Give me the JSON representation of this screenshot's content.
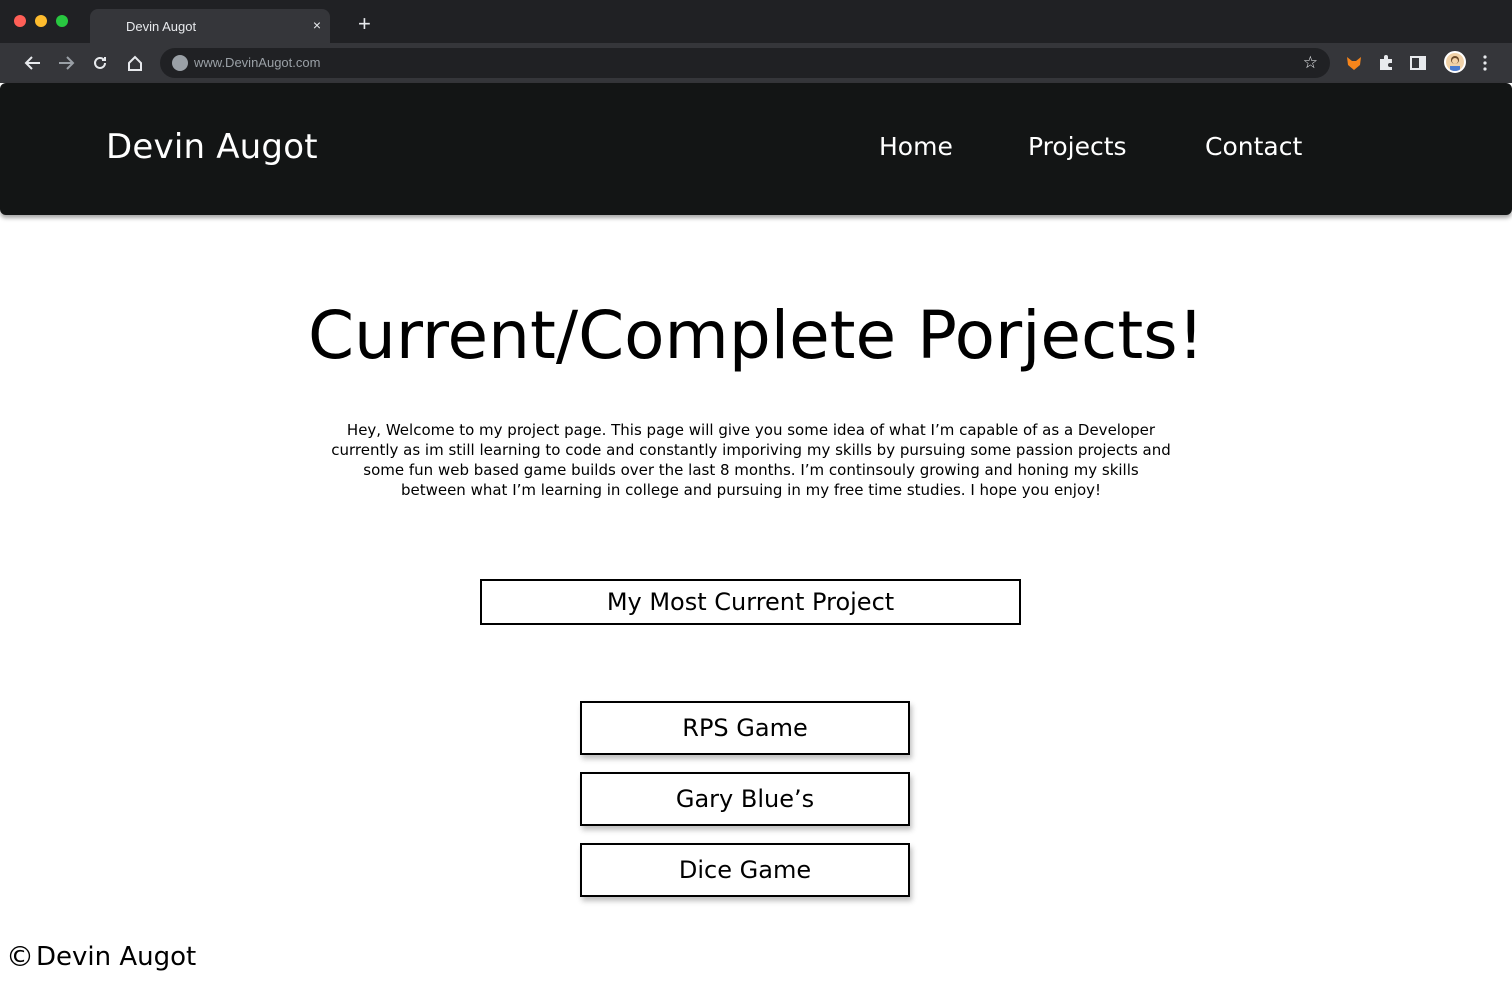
{
  "browser": {
    "tab_title": "Devin Augot",
    "tab_close": "×",
    "new_tab": "+",
    "url": "www.DevinAugot.com",
    "icons": [
      "back-icon",
      "forward-icon",
      "reload-icon",
      "home-icon",
      "star-icon",
      "fox-extension-icon",
      "puzzle-extension-icon",
      "side-panel-icon",
      "profile-avatar",
      "kebab-menu-icon"
    ]
  },
  "header": {
    "brand": "Devin Augot",
    "nav": [
      "Home",
      "Projects",
      "Contact"
    ]
  },
  "main": {
    "title": "Current/Complete Porjects!",
    "intro": "Hey, Welcome to my project page. This page will give you some idea of what I’m capable of as a Developer currently as im still learning to code and constantly imporiving my skills by pursuing some passion projects and some fun web based game builds over the last 8 months. I’m continsouly growing and honing my skills between what I’m learning in college and pursuing in my free time studies. I hope you enjoy!",
    "current_project_label": "My Most Current Project",
    "projects": [
      "RPS Game",
      "Gary Blue’s",
      "Dice Game"
    ]
  },
  "footer": {
    "copyright_symbol": "©",
    "name": "Devin Augot"
  },
  "colors": {
    "header_bg": "#131515",
    "chrome_dark": "#202124",
    "chrome_mid": "#35363a"
  }
}
